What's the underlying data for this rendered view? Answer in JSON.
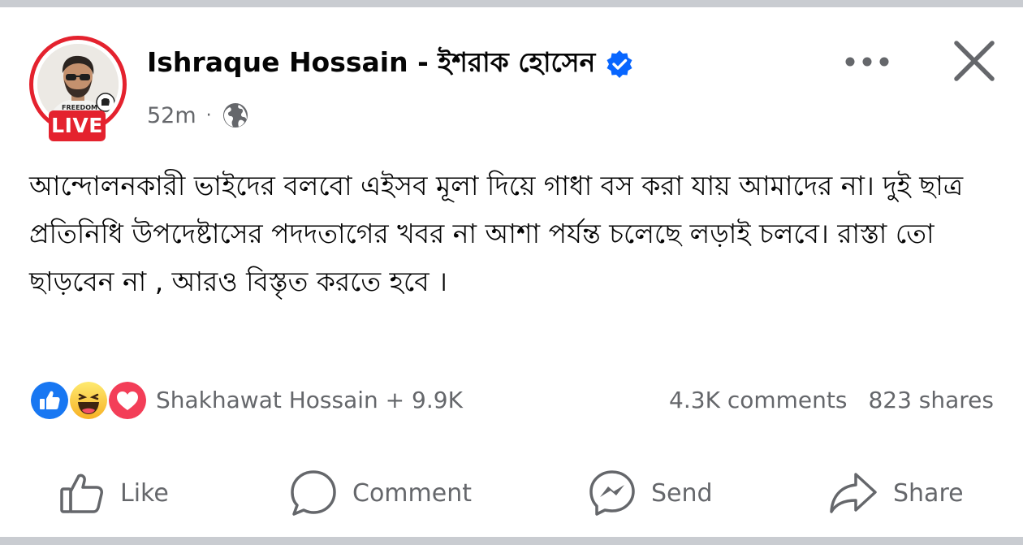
{
  "post": {
    "author": "Ishraque Hossain - ইশরাক হোসেন",
    "avatar_badge_text": "FREEDOM",
    "live_label": "LIVE",
    "timestamp": "52m",
    "meta_separator": "·",
    "privacy_icon": "globe-icon",
    "verified_icon": "verified-badge-icon",
    "text": "আন্দোলনকারী ভাইদের বলবো এইসব মূলা দিয়ে গাধা বস করা যায় আমাদের না। দুই ছাত্র প্রতিনিধি উপদেষ্টাসের পদদতাগের খবর না আশা পর্যন্ত চলেছে লড়াই চলবে। রাস্তা তো ছাড়বেন না , আরও বিস্তৃত করতে হবে ।"
  },
  "engagement": {
    "reaction_icons": [
      "like-reaction-icon",
      "haha-reaction-icon",
      "love-reaction-icon"
    ],
    "reaction_summary": "Shakhawat Hossain + 9.9K",
    "comments": "4.3K comments",
    "shares": "823 shares"
  },
  "actions": {
    "like": "Like",
    "comment": "Comment",
    "send": "Send",
    "share": "Share"
  },
  "colors": {
    "live_red": "#e4222e",
    "verified_blue": "#0866ff",
    "secondary_text": "#65676b",
    "frame_gray": "#c9ccd1",
    "love_red": "#f33e58",
    "haha_yellow": "#f7b125"
  }
}
